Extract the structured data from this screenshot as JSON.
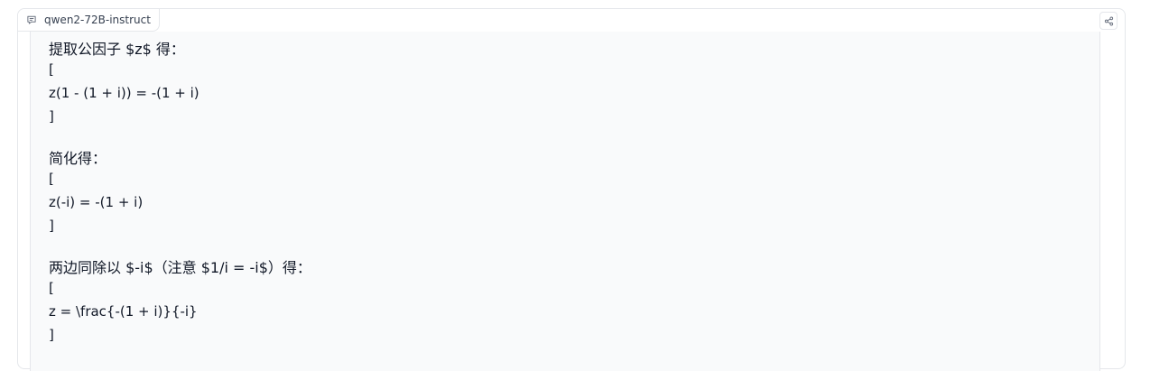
{
  "tab": {
    "label": "qwen2-72B-instruct",
    "icon": "chat-bubble-icon"
  },
  "share": {
    "icon": "share-icon"
  },
  "lines": [
    "提取公因子 $z$ 得：",
    "[",
    "z(1 - (1 + i)) = -(1 + i)",
    "]",
    "简化得：",
    "[",
    "z(-i) = -(1 + i)",
    "]",
    "两边同除以 $-i$（注意 $1/i = -i$）得：",
    "[",
    "z = \\frac{-(1 + i)}{-i}",
    "]"
  ]
}
